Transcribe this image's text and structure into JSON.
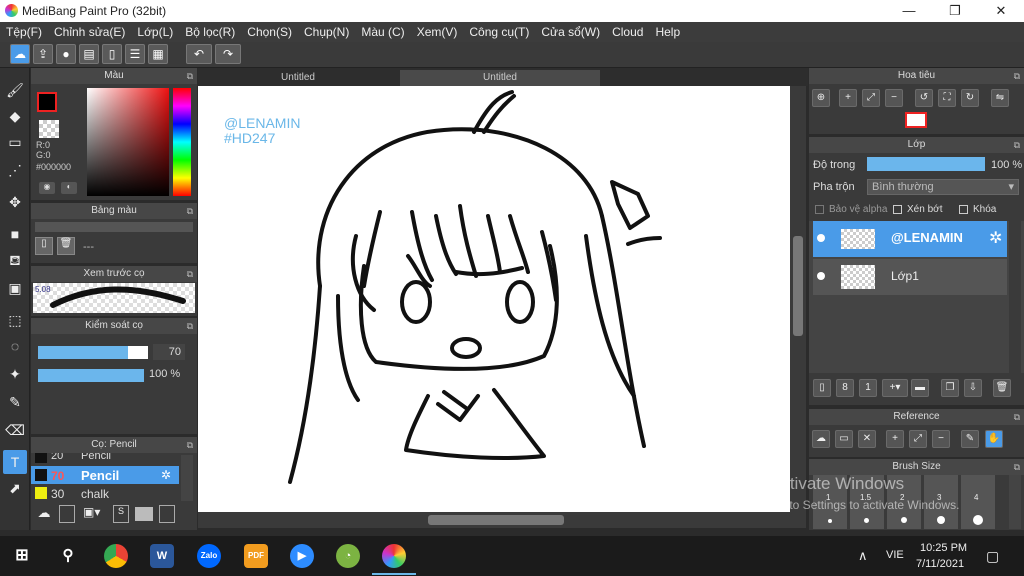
{
  "window": {
    "title": "MediBang Paint Pro (32bit)",
    "minimize": "—",
    "maximize": "❐",
    "close": "✕"
  },
  "menu": [
    "Tệp(F)",
    "Chỉnh sửa(E)",
    "Lớp(L)",
    "Bộ lọc(R)",
    "Chọn(S)",
    "Chụp(N)",
    "Màu (C)",
    "Xem(V)",
    "Công cụ(T)",
    "Cửa sổ(W)",
    "Cloud",
    "Help"
  ],
  "tabs": [
    "Untitled",
    "Untitled"
  ],
  "color_panel": {
    "title": "Màu",
    "r": "R:0",
    "g": "G:0",
    "hex": "#000000"
  },
  "palette_panel": {
    "title": "Bảng màu",
    "value": "---"
  },
  "brush_preview": {
    "title": "Xem trước cọ",
    "size": "5.08"
  },
  "brush_control": {
    "title": "Kiểm soát cọ",
    "size": "70",
    "opacity": "100 %",
    "size_fill": 0.82,
    "opacity_fill": 1.0
  },
  "brush_list": {
    "title": "Cọ: Pencil",
    "items": [
      {
        "size": "20",
        "name": "Pencil",
        "selected": false
      },
      {
        "size": "70",
        "name": "Pencil",
        "selected": true
      },
      {
        "size": "30",
        "name": "chalk",
        "selected": false
      }
    ]
  },
  "navigator": {
    "title": "Hoa tiêu"
  },
  "layer_panel": {
    "title": "Lớp",
    "opacity_label": "Độ trong",
    "opacity_value": "100 %",
    "blend_label": "Pha trộn",
    "blend_value": "Bình thường",
    "protect_alpha": "Bảo vệ alpha",
    "clipping": "Xén bớt",
    "lock": "Khóa",
    "layers": [
      {
        "name": "@LENAMIN",
        "selected": true
      },
      {
        "name": "Lớp1",
        "selected": false
      }
    ]
  },
  "reference_panel": {
    "title": "Reference"
  },
  "brush_size_panel": {
    "title": "Brush Size",
    "sizes": [
      "1",
      "1.5",
      "2",
      "3",
      "4"
    ]
  },
  "canvas_text": {
    "line1": "@LENAMIN",
    "line2": "#HD247"
  },
  "watermark": {
    "line1": "Activate Windows",
    "line2": "Go to Settings to activate Windows."
  },
  "taskbar": {
    "lang": "VIE",
    "time": "10:25 PM",
    "date": "7/11/2021"
  },
  "colors": {
    "accent": "#4a9be8",
    "canvas_text": "#6ab7e8",
    "brush_size_red": "#ff5555"
  }
}
